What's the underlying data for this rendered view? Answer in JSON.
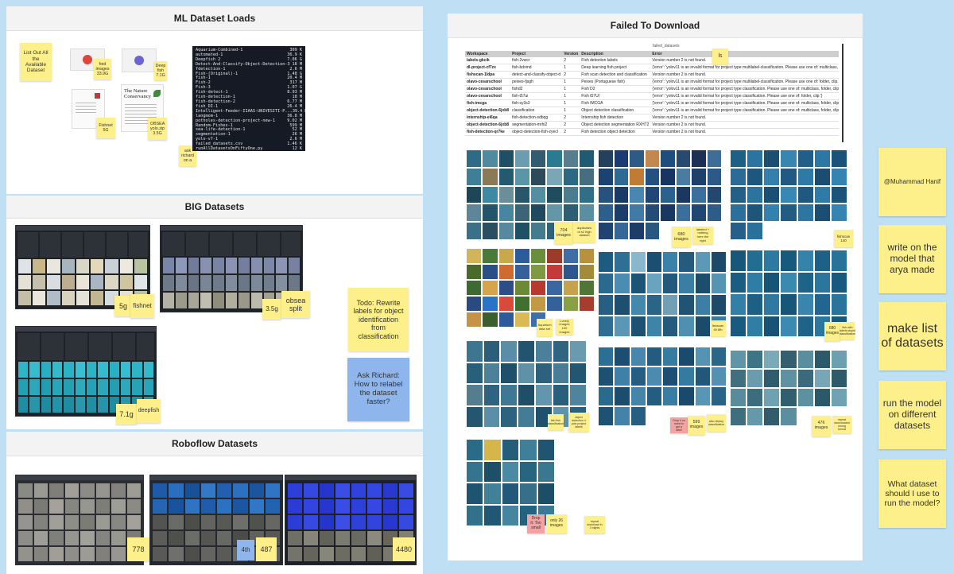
{
  "frames": {
    "ml_dataset_loads": "ML Dataset Loads",
    "big_datasets": "BIG Datasets",
    "roboflow_datasets": "Roboflow Datasets",
    "failed_to_download": "Failed To Download"
  },
  "ml_loads": {
    "sticky_list": "List Out All the Available Dataset",
    "sticky_foid": "foid images 33.9G",
    "sticky_deep": "Deep fish 7.1G",
    "sticky_fishnet": "Fishnet 5G",
    "sticky_obsea": "OBSEA yolo.zip 3.5G",
    "sticky_ask": "ask richard on a",
    "nature_logo": "The Nature Conservancy",
    "terminal_rows": [
      {
        "name": "Aquarium-Combined-1",
        "size": "309 K"
      },
      {
        "name": "automated-1",
        "size": "36.9 K"
      },
      {
        "name": "Deepfish 2",
        "size": "7.06 G"
      },
      {
        "name": "Detect-And-Classify-Object-Detection-3",
        "size": "18 M"
      },
      {
        "name": "fdetection-1",
        "size": "2.6 M"
      },
      {
        "name": "Fish-(Original)-1",
        "size": "1.48 G"
      },
      {
        "name": "fish-1",
        "size": "20.4 M"
      },
      {
        "name": "Fish-2",
        "size": "317 M"
      },
      {
        "name": "Fish-3",
        "size": "1.07 G"
      },
      {
        "name": "fish-detect-1",
        "size": "8.93 M"
      },
      {
        "name": "fish-detection-1",
        "size": "18 M"
      },
      {
        "name": "fish-detection-2",
        "size": "6.77 M"
      },
      {
        "name": "fish_DI-1",
        "size": "26.4 M"
      },
      {
        "name": "Intelligent-Feeder-IIAAS-UNIVESITI-P...",
        "size": "39.4 M"
      },
      {
        "name": "langmom-1",
        "size": "36.8 M"
      },
      {
        "name": "potholes-detection-project-new-1",
        "size": "9.02 M"
      },
      {
        "name": "Random-Fishes-1",
        "size": "599 M"
      },
      {
        "name": "sea-life-detection-1",
        "size": "52 M"
      },
      {
        "name": "segmentation-1",
        "size": "26 M"
      },
      {
        "name": "yolo-v7-1",
        "size": "2.6 M"
      },
      {
        "name": "failed_datasets.csv",
        "size": "1.46 K"
      },
      {
        "name": "runAllDatasetsOnFiftyOne.py",
        "size": "12 K"
      }
    ]
  },
  "big": {
    "s1_size": "5g",
    "s1_name": "fishnet",
    "s2_size": "3.5g",
    "s2_name": "obsea split",
    "s3_size": "7.1g",
    "s3_name": "deepfish",
    "todo": "Todo: Rewrite labels for object identification from classification",
    "ask": "Ask Richard: How to relabel the dataset faster?"
  },
  "roboflow": {
    "n1": "778",
    "tag4": "4th",
    "n2": "487",
    "n3": "4480"
  },
  "failed": {
    "doc_title": "failed_datasets",
    "ls_note": "ls",
    "headers": [
      "Workspace",
      "Project",
      "Version",
      "Description",
      "Error"
    ],
    "rows": [
      [
        "labels-gkcik",
        "fish-2vwcr",
        "2",
        "Fish detection labels",
        "Version number 2 is not found."
      ],
      [
        "dl-project-cf7zx",
        "fish-bdxmd",
        "1",
        "Deep learning fish project",
        "{'error': 'yolov11 is an invalid format for project type multilabel-classification. Please use one of: multiclass, folder, clip.'}"
      ],
      [
        "fishscan-1ldpa",
        "detect-and-classify-object-d",
        "2",
        "Fish scan detection and classification",
        "Version number 2 is not found."
      ],
      [
        "olavo-cesarschool",
        "peixes-fjsgh",
        "1",
        "Peixes (Portuguese fish)",
        "{'error': 'yolov11 is an invalid format for project type multilabel-classification. Please use one of: folder, clip.'}"
      ],
      [
        "olavo-cesarschool",
        "fishd2",
        "1",
        "Fish D2",
        "{'error': 'yolov11 is an invalid format for project type classification. Please use one of: multiclass, folder, clip.'}"
      ],
      [
        "olavo-cesarschool",
        "fish-t57ui",
        "1",
        "Fish t57UI",
        "{'error': 'yolov11 is an invalid format for project type classification. Please use one of: folder, clip.'}"
      ],
      [
        "fish-imcga",
        "fish-sy3s3",
        "1",
        "Fish IMCGA",
        "{'error': 'yolov11 is an invalid format for project type classification. Please use one of: multiclass, folder, clip.'}"
      ],
      [
        "object-detection-6jxb8",
        "classification",
        "1",
        "Object detection classification",
        "{'error': 'yolov11 is an invalid format for project type classification. Please use one of: multiclass, folder, clip.'}"
      ],
      [
        "internship-ei6qa",
        "fish-detection-sdbqg",
        "2",
        "Internship fish detection",
        "Version number 2 is not found."
      ],
      [
        "object-detection-6jxb8",
        "segmentation-mrhi2",
        "2",
        "Object detection segmentation RXH72",
        "Version number 2 is not found."
      ],
      [
        "fish-detection-qr7ke",
        "object-detection-fish-zyecl",
        "2",
        "Fish detection object detection",
        "Version number 2 is not found."
      ]
    ],
    "c704_num": "704 images",
    "c704_note": "duplicates of s2 high dataset",
    "c680_num": "680 images",
    "c680_note": "labeled + nothing here the right",
    "c_fishscan": "fishscan 140",
    "c_fishscan2": "fishscan 40 8fb",
    "c_aquarium": "Aquarium data set",
    "c_labelled": "Lovely images 100 images",
    "c680b_num": "680 images",
    "c680b_note": "fish with labels stupid classification",
    "c_fishclass": "fish fish classification",
    "c_objdet": "object detection 4 yolo project labels",
    "c_pink1": "Drop it no need to get a label",
    "c599_num": "599 images",
    "c599_note": "also deploy classification",
    "c476_num": "476 images",
    "c476_note": "repeat downloaded wrong format",
    "c_drop": "Drop it: Too small",
    "c_only26": "only 26 images",
    "c_smallnote": "repeat download in 3 nights"
  },
  "right_notes": {
    "mention": "@Muhammad Hanif",
    "model": "write on the model that arya made",
    "make_list": "make list of datasets",
    "run_model": "run the model on different datasets",
    "what_dataset": "What dataset should I use to run the model?"
  },
  "colors": {
    "board_bg": "#bfdff5",
    "sticky_yellow": "#fdf08a",
    "sticky_blue": "#8fb6ec",
    "sticky_pink": "#f4a2a2"
  }
}
